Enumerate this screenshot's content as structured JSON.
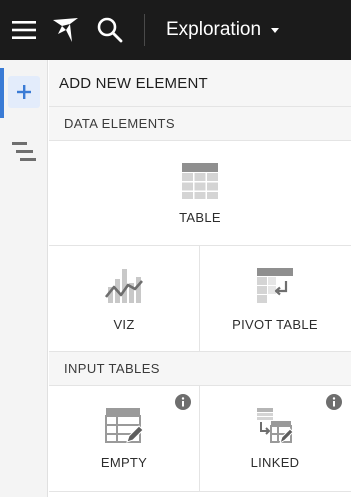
{
  "topbar": {
    "workbook_title": "Exploration"
  },
  "icons": {
    "menu": "menu-icon",
    "logo": "logo-icon",
    "search": "search-icon",
    "add": "plus-icon",
    "outline": "outline-icon",
    "info": "info-icon"
  },
  "colors": {
    "topbar_bg": "#1b1b1b",
    "accent": "#3a7bd5",
    "panel_header_bg": "#f6f6f6"
  },
  "panel": {
    "title": "ADD NEW ELEMENT",
    "sections": [
      {
        "title": "DATA ELEMENTS",
        "tiles": [
          {
            "label": "TABLE"
          },
          {
            "label": "VIZ"
          },
          {
            "label": "PIVOT TABLE"
          }
        ]
      },
      {
        "title": "INPUT TABLES",
        "tiles": [
          {
            "label": "EMPTY"
          },
          {
            "label": "LINKED"
          }
        ]
      }
    ]
  }
}
